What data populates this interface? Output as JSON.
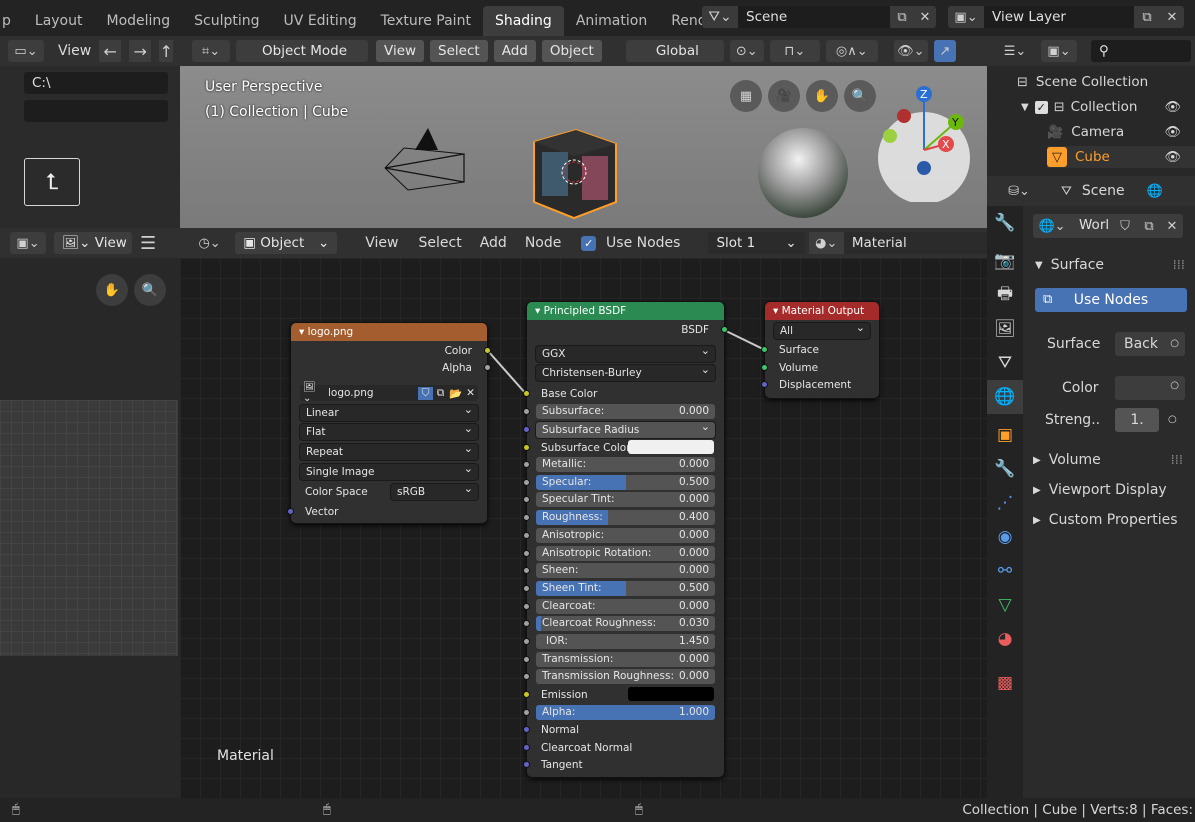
{
  "workspace_tabs": [
    "p",
    "Layout",
    "Modeling",
    "Sculpting",
    "UV Editing",
    "Texture Paint",
    "Shading",
    "Animation",
    "Rende"
  ],
  "scene_name": "Scene",
  "view_layer": "View Layer",
  "file_browser": {
    "view": "View",
    "path": "C:\\",
    "filter": ""
  },
  "viewport": {
    "mode": "Object Mode",
    "menus": [
      "View",
      "Select",
      "Add",
      "Object"
    ],
    "transform": "Global",
    "info_line1": "User Perspective",
    "info_line2": "(1) Collection | Cube"
  },
  "image_editor": {
    "view": "View"
  },
  "node_header": {
    "editor": "Object",
    "menus": [
      "View",
      "Select",
      "Add",
      "Node"
    ],
    "use_nodes": "Use Nodes",
    "slot": "Slot 1",
    "material": "Material"
  },
  "node_area_label": "Material",
  "node_image": {
    "title": "logo.png",
    "out_color": "Color",
    "out_alpha": "Alpha",
    "image": "logo.png",
    "interpolation": "Linear",
    "projection": "Flat",
    "extension": "Repeat",
    "source": "Single Image",
    "color_space_label": "Color Space",
    "color_space": "sRGB",
    "in_vector": "Vector"
  },
  "node_bsdf": {
    "title": "Principled BSDF",
    "out": "BSDF",
    "distribution": "GGX",
    "subsurface_method": "Christensen-Burley",
    "base_color": "Base Color",
    "subsurface": {
      "label": "Subsurface:",
      "value": "0.000"
    },
    "subsurface_radius": "Subsurface Radius",
    "subsurface_color": "Subsurface Color",
    "params": [
      {
        "label": "Metallic:",
        "value": "0.000",
        "fill": 0
      },
      {
        "label": "Specular:",
        "value": "0.500",
        "fill": 0.5
      },
      {
        "label": "Specular Tint:",
        "value": "0.000",
        "fill": 0
      },
      {
        "label": "Roughness:",
        "value": "0.400",
        "fill": 0.4
      },
      {
        "label": "Anisotropic:",
        "value": "0.000",
        "fill": 0
      },
      {
        "label": "Anisotropic Rotation:",
        "value": "0.000",
        "fill": 0
      },
      {
        "label": "Sheen:",
        "value": "0.000",
        "fill": 0
      },
      {
        "label": "Sheen Tint:",
        "value": "0.500",
        "fill": 0.5
      },
      {
        "label": "Clearcoat:",
        "value": "0.000",
        "fill": 0
      },
      {
        "label": "Clearcoat Roughness:",
        "value": "0.030",
        "fill": 0.03
      },
      {
        "label": "IOR:",
        "value": "1.450",
        "fill": 0
      },
      {
        "label": "Transmission:",
        "value": "0.000",
        "fill": 0
      },
      {
        "label": "Transmission Roughness:",
        "value": "0.000",
        "fill": 0
      }
    ],
    "emission": "Emission",
    "alpha": {
      "label": "Alpha:",
      "value": "1.000",
      "fill": 1
    },
    "normal": "Normal",
    "clearcoat_normal": "Clearcoat Normal",
    "tangent": "Tangent"
  },
  "node_output": {
    "title": "Material Output",
    "target": "All",
    "surface": "Surface",
    "volume": "Volume",
    "displacement": "Displacement"
  },
  "outliner": {
    "root": "Scene Collection",
    "collection": "Collection",
    "camera": "Camera",
    "cube": "Cube"
  },
  "properties": {
    "scene": "Scene",
    "world": "Worl",
    "surface_panel": "Surface",
    "use_nodes": "Use Nodes",
    "surface_label": "Surface",
    "surface_value": "Back",
    "color_label": "Color",
    "strength_label": "Streng..",
    "strength_value": "1.",
    "volume": "Volume",
    "viewport_display": "Viewport Display",
    "custom_props": "Custom Properties"
  },
  "statusbar": "Collection | Cube | Verts:8 | Faces:",
  "colors": {
    "accent": "#4772b3",
    "active_orange": "#ff9e2a",
    "texture_header": "#a35d2e",
    "shader_header": "#2a8a52",
    "output_header": "#a52a2a"
  }
}
